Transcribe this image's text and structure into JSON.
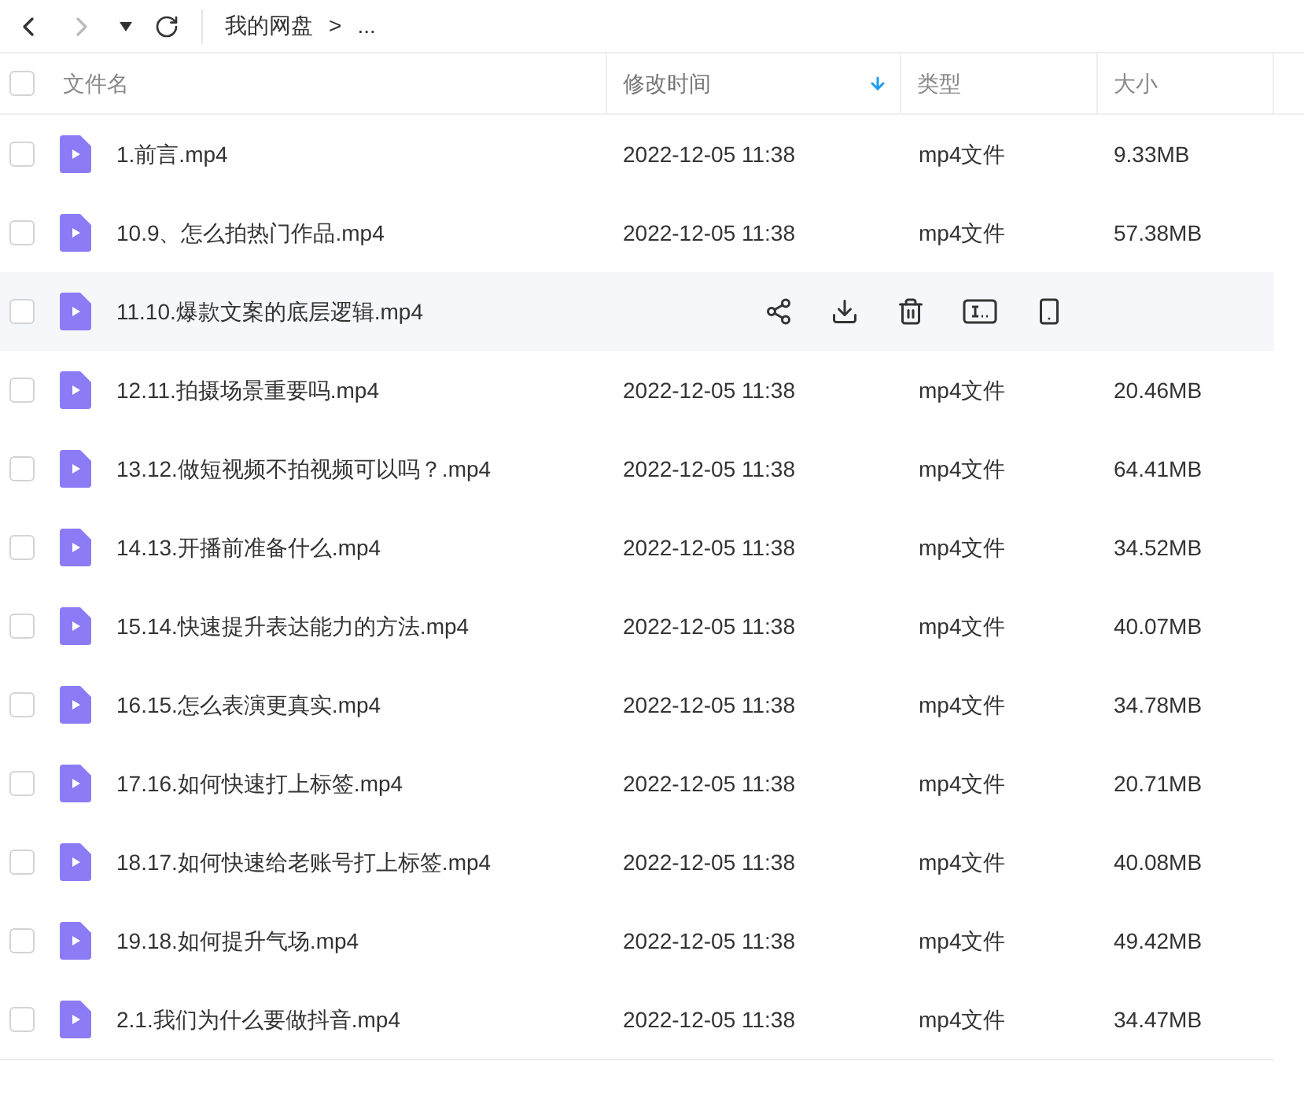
{
  "toolbar": {
    "breadcrumb": [
      "我的网盘",
      ">",
      "..."
    ]
  },
  "table": {
    "select_all_checked": false,
    "columns": [
      {
        "label": "文件名",
        "sorted": false
      },
      {
        "label": "修改时间",
        "sorted": true
      },
      {
        "label": "类型",
        "sorted": false
      },
      {
        "label": "大小",
        "sorted": false
      }
    ],
    "rows": [
      {
        "name": "1.前言.mp4",
        "hovered": false,
        "checked": false,
        "modified": "2022-12-05 11:38",
        "type": "mp4文件",
        "size": "9.33MB"
      },
      {
        "name": "10.9、怎么拍热门作品.mp4",
        "hovered": false,
        "checked": false,
        "modified": "2022-12-05 11:38",
        "type": "mp4文件",
        "size": "57.38MB"
      },
      {
        "name": "11.10.爆款文案的底层逻辑.mp4",
        "hovered": true,
        "checked": false
      },
      {
        "name": "12.11.拍摄场景重要吗.mp4",
        "hovered": false,
        "checked": false,
        "modified": "2022-12-05 11:38",
        "type": "mp4文件",
        "size": "20.46MB"
      },
      {
        "name": "13.12.做短视频不拍视频可以吗？.mp4",
        "hovered": false,
        "checked": false,
        "modified": "2022-12-05 11:38",
        "type": "mp4文件",
        "size": "64.41MB"
      },
      {
        "name": "14.13.开播前准备什么.mp4",
        "hovered": false,
        "checked": false,
        "modified": "2022-12-05 11:38",
        "type": "mp4文件",
        "size": "34.52MB"
      },
      {
        "name": "15.14.快速提升表达能力的方法.mp4",
        "hovered": false,
        "checked": false,
        "modified": "2022-12-05 11:38",
        "type": "mp4文件",
        "size": "40.07MB"
      },
      {
        "name": "16.15.怎么表演更真实.mp4",
        "hovered": false,
        "checked": false,
        "modified": "2022-12-05 11:38",
        "type": "mp4文件",
        "size": "34.78MB"
      },
      {
        "name": "17.16.如何快速打上标签.mp4",
        "hovered": false,
        "checked": false,
        "modified": "2022-12-05 11:38",
        "type": "mp4文件",
        "size": "20.71MB"
      },
      {
        "name": "18.17.如何快速给老账号打上标签.mp4",
        "hovered": false,
        "checked": false,
        "modified": "2022-12-05 11:38",
        "type": "mp4文件",
        "size": "40.08MB"
      },
      {
        "name": "19.18.如何提升气场.mp4",
        "hovered": false,
        "checked": false,
        "modified": "2022-12-05 11:38",
        "type": "mp4文件",
        "size": "49.42MB"
      },
      {
        "name": "2.1.我们为什么要做抖音.mp4",
        "hovered": false,
        "checked": false,
        "modified": "2022-12-05 11:38",
        "type": "mp4文件",
        "size": "34.47MB"
      }
    ]
  }
}
